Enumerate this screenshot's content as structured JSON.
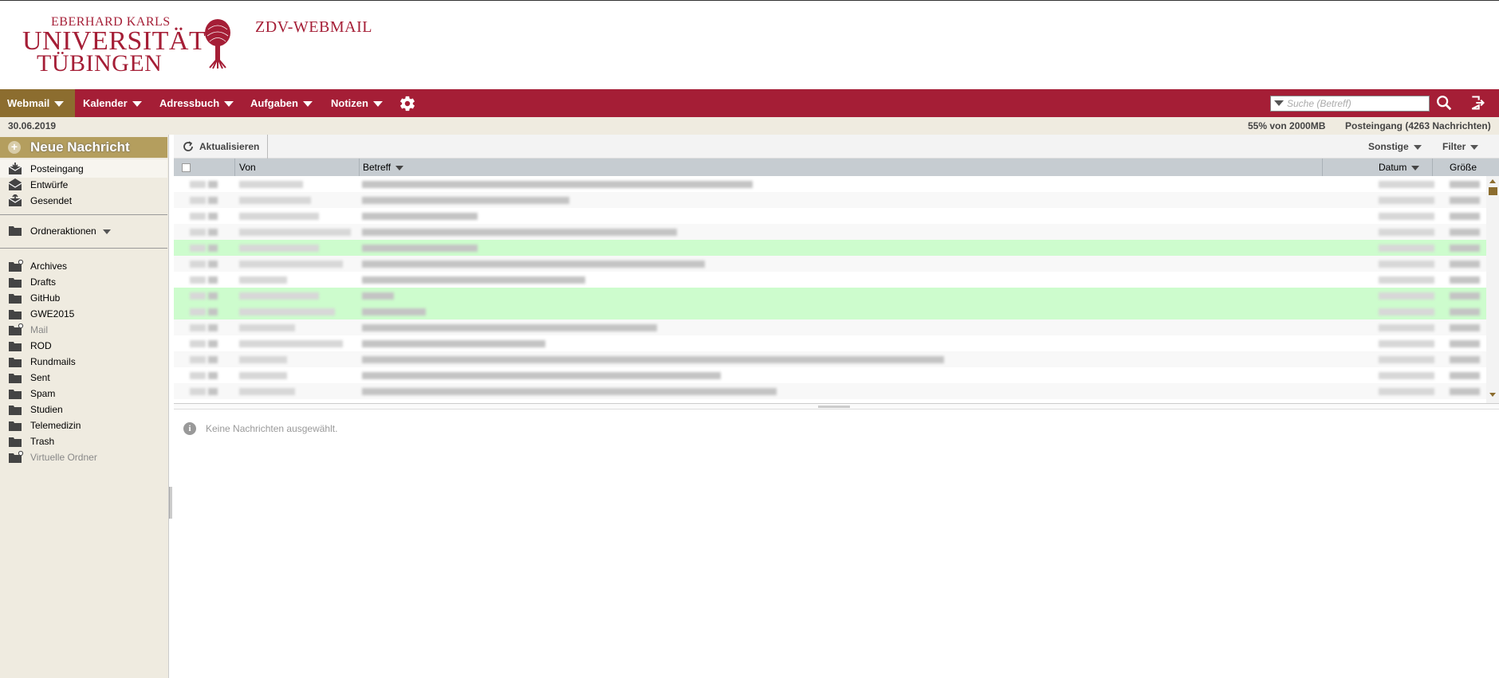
{
  "header": {
    "logo_line1": "EBERHARD KARLS",
    "logo_line2": "UNIVERSITÄT",
    "logo_line3": "TÜBINGEN",
    "app_name": "ZDV-WEBMAIL"
  },
  "nav": {
    "items": [
      {
        "label": "Webmail",
        "active": true
      },
      {
        "label": "Kalender"
      },
      {
        "label": "Adressbuch"
      },
      {
        "label": "Aufgaben"
      },
      {
        "label": "Notizen"
      }
    ],
    "search_placeholder": "Suche (Betreff)",
    "icons": [
      "gear-icon",
      "search-icon",
      "logout-icon"
    ]
  },
  "status": {
    "date": "30.06.2019",
    "quota": "55% von 2000MB",
    "folder_info": "Posteingang (4263 Nachrichten)"
  },
  "sidebar": {
    "new_message": "Neue Nachricht",
    "special_folders": [
      {
        "label": "Posteingang",
        "icon": "inbox-icon"
      },
      {
        "label": "Entwürfe",
        "icon": "drafts-icon"
      },
      {
        "label": "Gesendet",
        "icon": "sent-icon"
      }
    ],
    "folder_actions": "Ordneraktionen",
    "folders": [
      {
        "label": "Archives",
        "icon": "folder-plus-icon"
      },
      {
        "label": "Drafts",
        "icon": "folder-icon"
      },
      {
        "label": "GitHub",
        "icon": "folder-icon"
      },
      {
        "label": "GWE2015",
        "icon": "folder-icon"
      },
      {
        "label": "Mail",
        "icon": "folder-plus-icon",
        "dim": true
      },
      {
        "label": "ROD",
        "icon": "folder-icon"
      },
      {
        "label": "Rundmails",
        "icon": "folder-icon"
      },
      {
        "label": "Sent",
        "icon": "folder-icon"
      },
      {
        "label": "Spam",
        "icon": "folder-icon"
      },
      {
        "label": "Studien",
        "icon": "folder-icon"
      },
      {
        "label": "Telemedizin",
        "icon": "folder-icon"
      },
      {
        "label": "Trash",
        "icon": "folder-icon"
      },
      {
        "label": "Virtuelle Ordner",
        "icon": "folder-plus-icon",
        "dim": true
      }
    ]
  },
  "toolbar": {
    "refresh": "Aktualisieren",
    "other": "Sonstige",
    "filter": "Filter"
  },
  "list": {
    "columns": {
      "from": "Von",
      "subject": "Betreff",
      "date": "Datum",
      "size": "Größe"
    },
    "rows": [
      {
        "highlighted": false
      },
      {
        "highlighted": false
      },
      {
        "highlighted": false
      },
      {
        "highlighted": false
      },
      {
        "highlighted": true
      },
      {
        "highlighted": false
      },
      {
        "highlighted": false
      },
      {
        "highlighted": true
      },
      {
        "highlighted": true
      },
      {
        "highlighted": false
      },
      {
        "highlighted": false
      },
      {
        "highlighted": false
      },
      {
        "highlighted": false
      },
      {
        "highlighted": false
      }
    ]
  },
  "preview": {
    "empty_message": "Keine Nachrichten ausgewählt."
  }
}
